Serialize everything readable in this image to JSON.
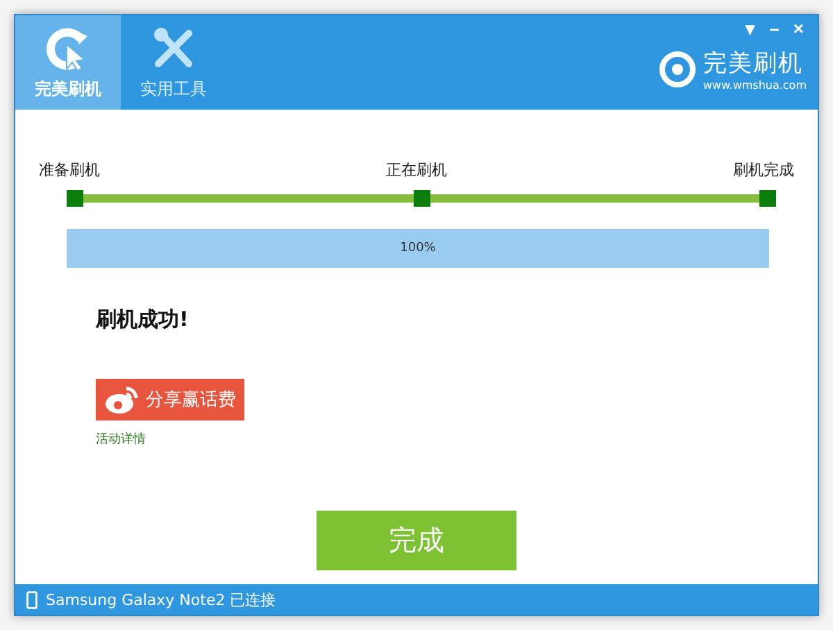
{
  "tabs": [
    {
      "label": "完美刷机",
      "kind": "flash",
      "selected": true
    },
    {
      "label": "实用工具",
      "kind": "tools",
      "selected": false
    }
  ],
  "window_controls": [
    "▾",
    "–",
    "×"
  ],
  "brand": {
    "name": "完美刷机",
    "url": "www.wmshua.com"
  },
  "steps": [
    {
      "label": "准备刷机",
      "done": true
    },
    {
      "label": "正在刷机",
      "done": true
    },
    {
      "label": "刷机完成",
      "done": true
    }
  ],
  "progress": {
    "level": 1,
    "reading": "100%"
  },
  "message": "刷机成功!",
  "share_button": "分享赢话费",
  "details_link": "活动详情",
  "done_button": "完成",
  "status_bar": {
    "device": "Samsung Galaxy Note2 已连接"
  }
}
